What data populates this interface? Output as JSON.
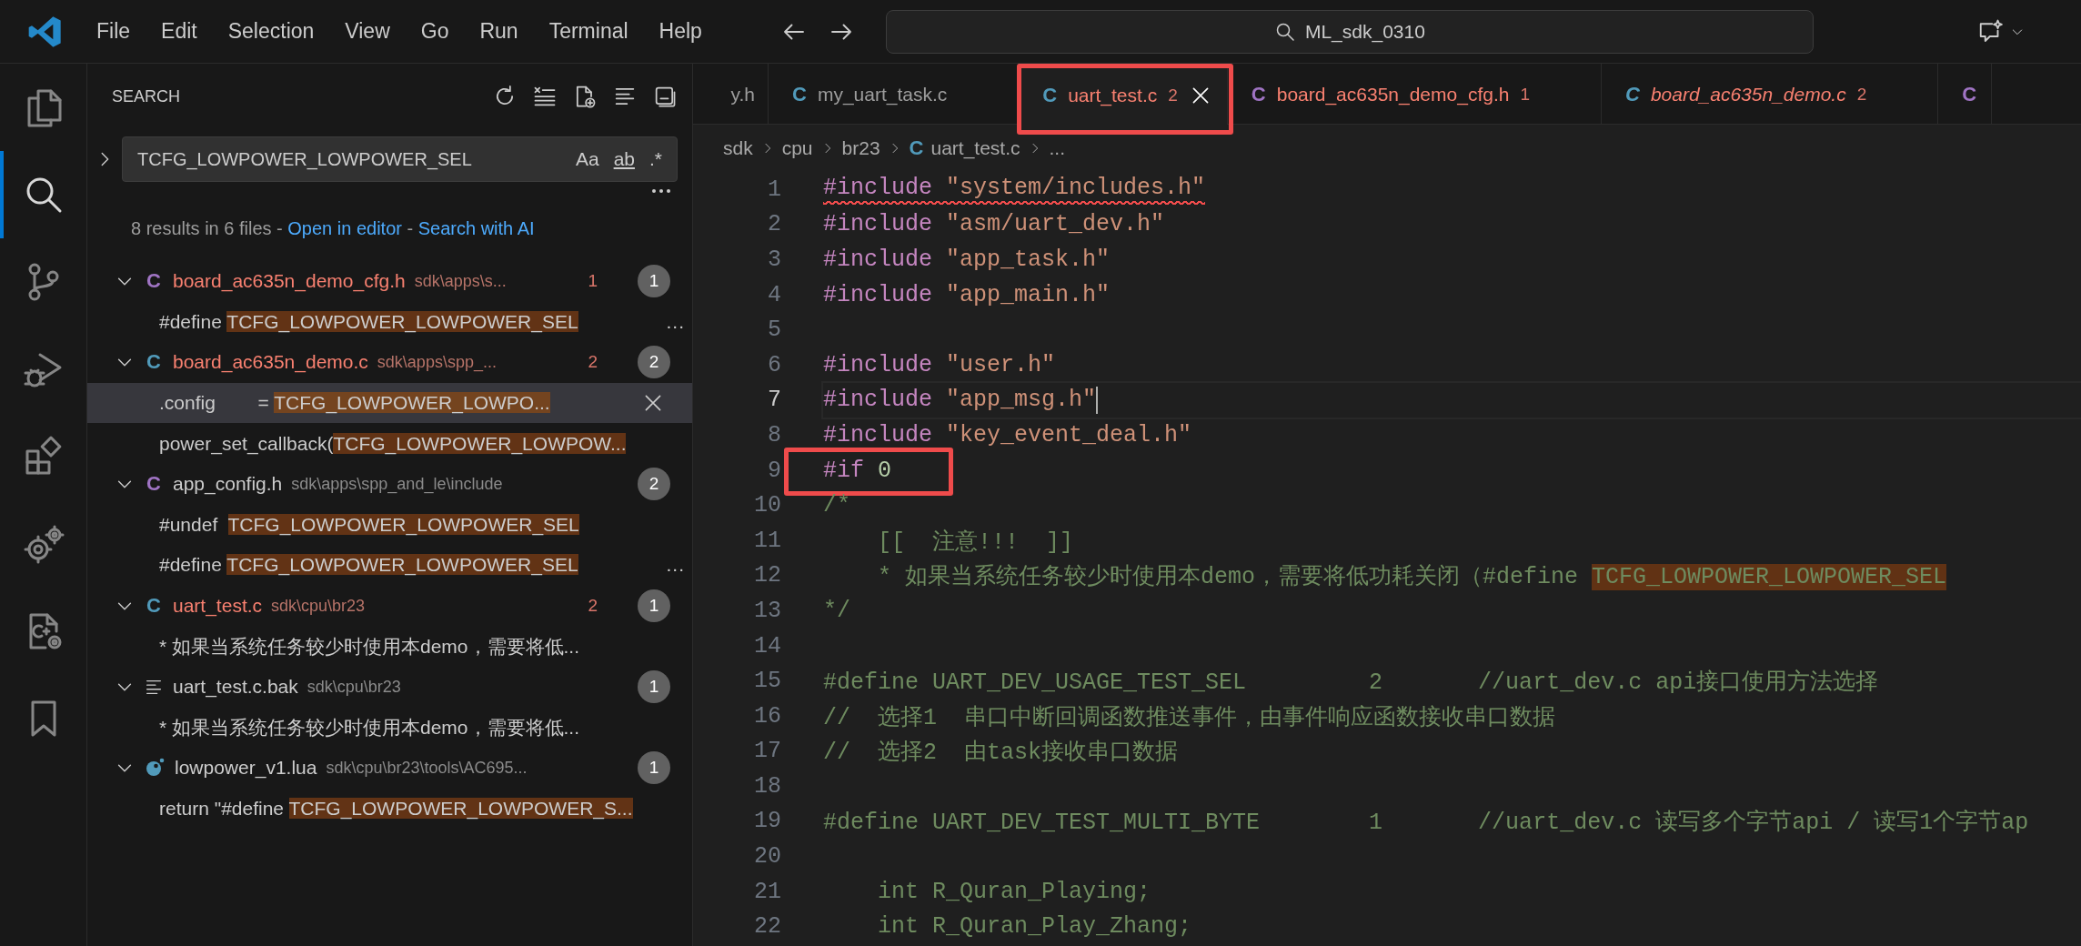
{
  "title_bar": {
    "menus": [
      "File",
      "Edit",
      "Selection",
      "View",
      "Go",
      "Run",
      "Terminal",
      "Help"
    ],
    "command_center": "ML_sdk_0310"
  },
  "activity_bar": [
    {
      "kind": "explorer",
      "selected": false
    },
    {
      "kind": "search",
      "selected": true
    },
    {
      "kind": "source_control",
      "selected": false
    },
    {
      "kind": "run_debug",
      "selected": false
    },
    {
      "kind": "extensions",
      "selected": false
    },
    {
      "kind": "gears",
      "selected": false
    },
    {
      "kind": "cpp_config",
      "selected": false
    },
    {
      "kind": "bookmarks",
      "selected": false
    }
  ],
  "sidebar": {
    "title": "SEARCH",
    "search": {
      "value": "TCFG_LOWPOWER_LOWPOWER_SEL",
      "options": [
        {
          "kind": "case",
          "label": "Aa",
          "on": false
        },
        {
          "kind": "word",
          "label": "ab",
          "on": false
        },
        {
          "kind": "regex",
          "label": ".*",
          "on": false
        }
      ]
    },
    "summary": [
      {
        "text": "8 results in 6 files - ",
        "link": false
      },
      {
        "text": "Open in editor",
        "link": true
      },
      {
        "text": " - ",
        "link": false
      },
      {
        "text": "Search with AI",
        "link": true
      }
    ],
    "results": [
      {
        "icon": {
          "kind": "glyph",
          "glyph": "C",
          "color": "#a074c4"
        },
        "name": "board_ac635n_demo_cfg.h",
        "path": "sdk\\apps\\s...",
        "error": true,
        "problems": "1",
        "count": "1",
        "matches": [
          {
            "before": "#define ",
            "match": "TCFG_LOWPOWER_LOWPOWER_SEL",
            "trailing": "...",
            "selected": false
          }
        ]
      },
      {
        "icon": {
          "kind": "glyph",
          "glyph": "C",
          "color": "#519aba"
        },
        "name": "board_ac635n_demo.c",
        "path": "sdk\\apps\\spp_...",
        "error": true,
        "problems": "2",
        "count": "2",
        "matches": [
          {
            "before": ".config        = ",
            "match": "TCFG_LOWPOWER_LOWPO...",
            "selected": true
          },
          {
            "before": "power_set_callback(",
            "match": "TCFG_LOWPOWER_LOWPOW...",
            "selected": false
          }
        ]
      },
      {
        "icon": {
          "kind": "glyph",
          "glyph": "C",
          "color": "#a074c4"
        },
        "name": "app_config.h",
        "path": "sdk\\apps\\spp_and_le\\include",
        "error": false,
        "count": "2",
        "matches": [
          {
            "before": "#undef  ",
            "match": "TCFG_LOWPOWER_LOWPOWER_SEL",
            "selected": false
          },
          {
            "before": "#define ",
            "match": "TCFG_LOWPOWER_LOWPOWER_SEL",
            "trailing": "...",
            "selected": false
          }
        ]
      },
      {
        "icon": {
          "kind": "glyph",
          "glyph": "C",
          "color": "#519aba"
        },
        "name": "uart_test.c",
        "path": "sdk\\cpu\\br23",
        "error": true,
        "problems": "2",
        "count": "1",
        "matches": [
          {
            "before": "* 如果当系统任务较少时使用本demo，需要将低...",
            "selected": false
          }
        ]
      },
      {
        "icon": {
          "kind": "text"
        },
        "name": "uart_test.c.bak",
        "path": "sdk\\cpu\\br23",
        "error": false,
        "count": "1",
        "matches": [
          {
            "before": "* 如果当系统任务较少时使用本demo，需要将低...",
            "selected": false
          }
        ]
      },
      {
        "icon": {
          "kind": "lua"
        },
        "name": "lowpower_v1.lua",
        "path": "sdk\\cpu\\br23\\tools\\AC695...",
        "error": false,
        "count": "1",
        "matches": [
          {
            "before": "return \"#define ",
            "match": "TCFG_LOWPOWER_LOWPOWER_S...",
            "selected": false
          }
        ]
      }
    ]
  },
  "tabs": [
    {
      "kind": "partial",
      "label": "y.h",
      "selected": false,
      "error": false,
      "italic": false
    },
    {
      "kind": "file",
      "icon": {
        "glyph": "C",
        "color": "#519aba"
      },
      "label": "my_uart_task.c",
      "selected": false,
      "error": false,
      "italic": false
    },
    {
      "kind": "file",
      "icon": {
        "glyph": "C",
        "color": "#519aba"
      },
      "label": "uart_test.c",
      "problems": "2",
      "selected": true,
      "error": true,
      "italic": false,
      "annotated": true
    },
    {
      "kind": "file",
      "icon": {
        "glyph": "C",
        "color": "#a074c4"
      },
      "label": "board_ac635n_demo_cfg.h",
      "problems": "1",
      "selected": false,
      "error": true,
      "italic": false
    },
    {
      "kind": "file",
      "icon": {
        "glyph": "C",
        "color": "#519aba"
      },
      "label": "board_ac635n_demo.c",
      "problems": "2",
      "selected": false,
      "error": true,
      "italic": true
    },
    {
      "kind": "icon_only",
      "icon": {
        "glyph": "C",
        "color": "#a074c4"
      },
      "selected": false,
      "italic": false
    }
  ],
  "breadcrumb": [
    {
      "kind": "folder",
      "text": "sdk"
    },
    {
      "kind": "folder",
      "text": "cpu"
    },
    {
      "kind": "folder",
      "text": "br23"
    },
    {
      "kind": "file",
      "glyph": "C",
      "color": "#519aba",
      "text": "uart_test.c"
    },
    {
      "kind": "more",
      "text": "..."
    }
  ],
  "editor": {
    "lines": [
      {
        "number": "1",
        "error": true,
        "tokens": [
          {
            "kind": "directive",
            "text": "#include "
          },
          {
            "kind": "string",
            "text": "\"system/includes.h\""
          }
        ]
      },
      {
        "number": "2",
        "tokens": [
          {
            "kind": "directive",
            "text": "#include "
          },
          {
            "kind": "string",
            "text": "\"asm/uart_dev.h\""
          }
        ]
      },
      {
        "number": "3",
        "tokens": [
          {
            "kind": "directive",
            "text": "#include "
          },
          {
            "kind": "string",
            "text": "\"app_task.h\""
          }
        ]
      },
      {
        "number": "4",
        "tokens": [
          {
            "kind": "directive",
            "text": "#include "
          },
          {
            "kind": "string",
            "text": "\"app_main.h\""
          }
        ]
      },
      {
        "number": "5"
      },
      {
        "number": "6",
        "tokens": [
          {
            "kind": "directive",
            "text": "#include "
          },
          {
            "kind": "string",
            "text": "\"user.h\""
          }
        ]
      },
      {
        "number": "7",
        "current": true,
        "tokens": [
          {
            "kind": "directive",
            "text": "#include "
          },
          {
            "kind": "string",
            "text": "\"app_msg.h\""
          }
        ]
      },
      {
        "number": "8",
        "tokens": [
          {
            "kind": "directive",
            "text": "#include "
          },
          {
            "kind": "string",
            "text": "\"key_event_deal.h\""
          }
        ]
      },
      {
        "number": "9",
        "annotated": true,
        "tokens": [
          {
            "kind": "directive",
            "text": "#if "
          },
          {
            "kind": "number",
            "text": "0"
          }
        ]
      },
      {
        "number": "10",
        "tokens": [
          {
            "kind": "inactive",
            "text": "/*"
          }
        ]
      },
      {
        "number": "11",
        "tokens": [
          {
            "kind": "inactive",
            "text": "    [[  注意!!!  ]]"
          }
        ]
      },
      {
        "number": "12",
        "tokens": [
          {
            "kind": "inactive",
            "text": "    * 如果当系统任务较少时使用本demo，需要将低功耗关闭（#define "
          },
          {
            "kind": "match",
            "text": "TCFG_LOWPOWER_LOWPOWER_SEL"
          }
        ]
      },
      {
        "number": "13",
        "tokens": [
          {
            "kind": "inactive",
            "text": "*/"
          }
        ]
      },
      {
        "number": "14"
      },
      {
        "number": "15",
        "tokens": [
          {
            "kind": "inactive",
            "text": "#define UART_DEV_USAGE_TEST_SEL         2       //uart_dev.c api接口使用方法选择"
          }
        ]
      },
      {
        "number": "16",
        "tokens": [
          {
            "kind": "inactive",
            "text": "//  选择1  串口中断回调函数推送事件，由事件响应函数接收串口数据"
          }
        ]
      },
      {
        "number": "17",
        "tokens": [
          {
            "kind": "inactive",
            "text": "//  选择2  由task接收串口数据"
          }
        ]
      },
      {
        "number": "18"
      },
      {
        "number": "19",
        "tokens": [
          {
            "kind": "inactive",
            "text": "#define UART_DEV_TEST_MULTI_BYTE        1       //uart_dev.c 读写多个字节api / 读写1个字节ap"
          }
        ]
      },
      {
        "number": "20"
      },
      {
        "number": "21",
        "tokens": [
          {
            "kind": "inactive",
            "text": "    int R_Quran_Playing;"
          }
        ]
      },
      {
        "number": "22",
        "tokens": [
          {
            "kind": "inactive",
            "text": "    int R_Quran_Play_Zhang;"
          }
        ]
      }
    ]
  }
}
